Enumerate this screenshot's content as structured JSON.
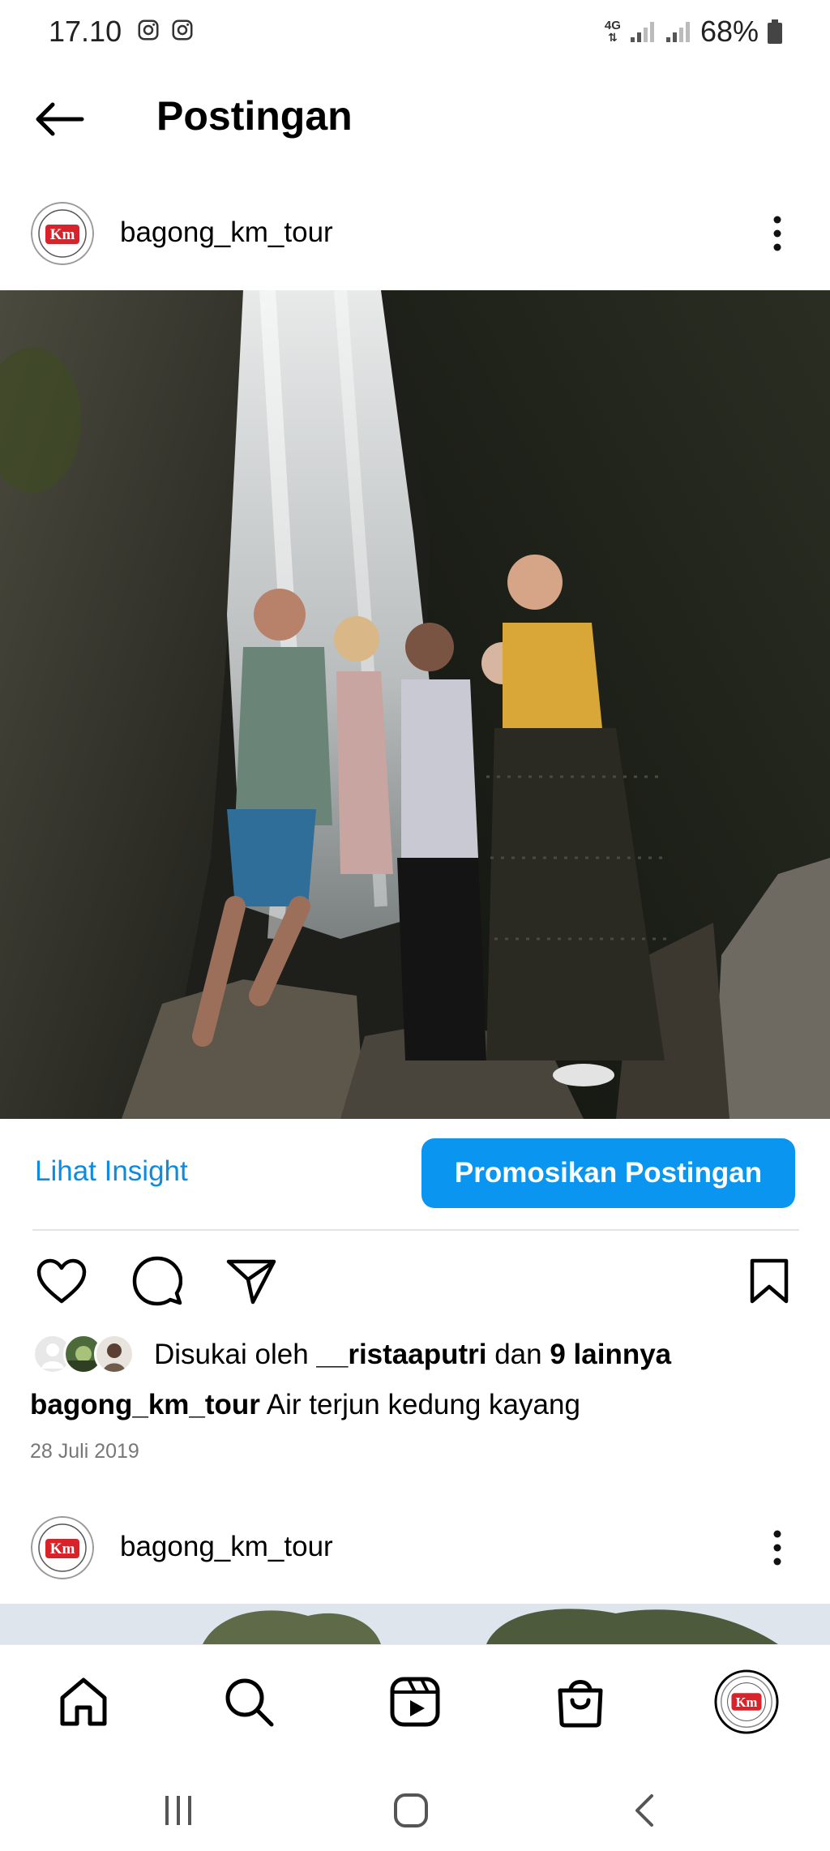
{
  "status_bar": {
    "time": "17.10",
    "network": "4G",
    "battery": "68%"
  },
  "header": {
    "title": "Postingan"
  },
  "post": {
    "username": "bagong_km_tour",
    "avatar_logo_text": "Km",
    "insight_label": "Lihat Insight",
    "promote_label": "Promosikan Postingan",
    "likes_prefix": "Disukai oleh",
    "likes_user": "__ristaaputri",
    "likes_conjunction": "dan",
    "likes_others": "9 lainnya",
    "caption_user": "bagong_km_tour",
    "caption_text": "Air terjun kedung kayang",
    "date": "28 Juli 2019"
  },
  "next_post": {
    "username": "bagong_km_tour"
  },
  "colors": {
    "accent": "#0a95f0",
    "link": "#0a8de0",
    "logo_red": "#d9232a"
  },
  "bottom_nav": [
    "home-icon",
    "search-icon",
    "reels-icon",
    "shop-icon",
    "profile-avatar"
  ],
  "system_nav": [
    "recent-apps-icon",
    "home-button-icon",
    "back-arrow-icon"
  ]
}
